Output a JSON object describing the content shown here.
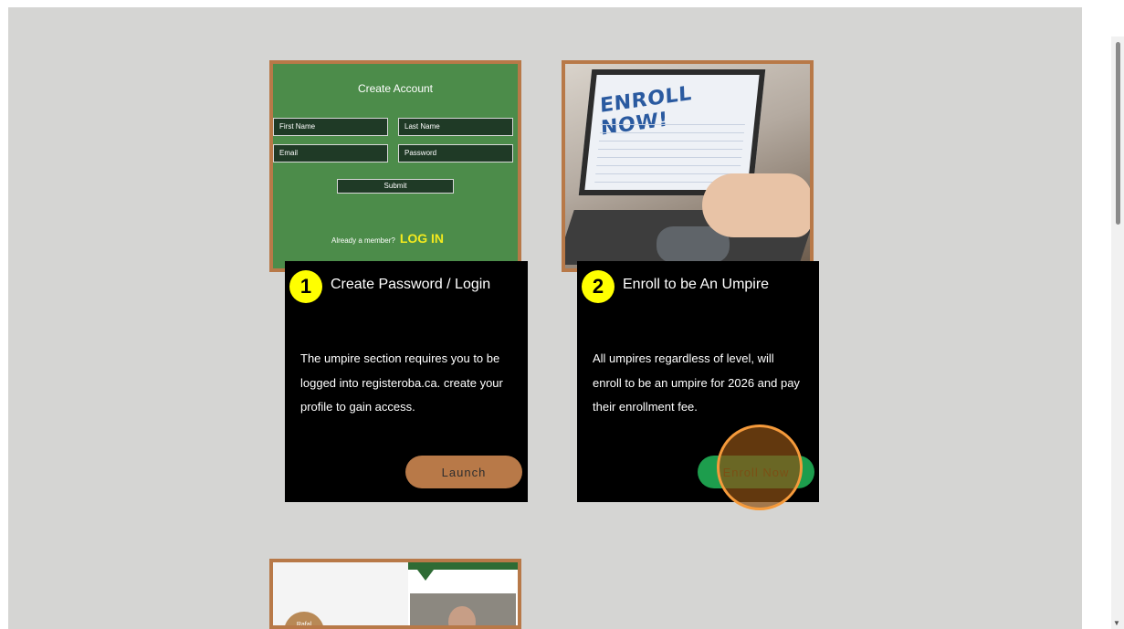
{
  "create_account_card": {
    "title": "Create Account",
    "fields": {
      "first_name": "First Name",
      "last_name": "Last Name",
      "email": "Email",
      "password": "Password"
    },
    "submit_label": "Submit",
    "member_prompt": "Already a member?",
    "login_label": "LOG IN"
  },
  "enroll_image": {
    "headline": "ENROLL NOW!"
  },
  "steps": [
    {
      "number": "1",
      "title": "Create Password / Login",
      "body": "The umpire section requires you to be logged into registeroba.ca.  create your profile to gain access.",
      "button_label": "Launch"
    },
    {
      "number": "2",
      "title": "Enroll to be An Umpire",
      "body": "All umpires regardless of level, will enroll to be an umpire for 2026 and pay their enrollment fee.",
      "button_label": "Enroll Now"
    }
  ],
  "bottom_card": {
    "badge_text": "Rafal"
  },
  "colors": {
    "page_background": "#d5d5d3",
    "card_frame": "#b87948",
    "launch_button": "#b87948",
    "enroll_button": "#1d9d4d",
    "step_badge": "#ffff00",
    "form_green": "#4c8c4a",
    "login_yellow": "#f3ea1e",
    "click_ring": "#f59a3b"
  },
  "icons": {
    "scroll_down": "triangle-down-icon"
  }
}
